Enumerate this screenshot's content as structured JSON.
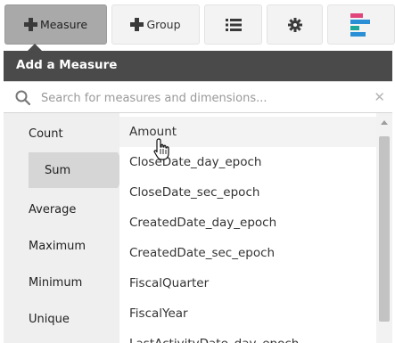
{
  "toolbar": {
    "measure_label": "Measure",
    "group_label": "Group",
    "list_icon": "list-icon",
    "settings_icon": "gear-icon",
    "chart_icon": "bar-chart-icon"
  },
  "panel": {
    "title": "Add a Measure",
    "search_placeholder": "Search for measures and dimensions...",
    "clear_icon": "close-icon"
  },
  "aggregates": [
    "Count",
    "Sum",
    "Average",
    "Maximum",
    "Minimum",
    "Unique"
  ],
  "selected_aggregate": "Sum",
  "fields": [
    "Amount",
    "CloseDate_day_epoch",
    "CloseDate_sec_epoch",
    "CreatedDate_day_epoch",
    "CreatedDate_sec_epoch",
    "FiscalQuarter",
    "FiscalYear",
    "LastActivityDate_day_epoch"
  ],
  "colors": {
    "active_button": "#a9a9a9",
    "panel_bg": "#4a4a4a",
    "chart_icon_pink": "#e0457b",
    "chart_icon_blue": "#2b8fd6",
    "chart_icon_teal": "#1fa89a"
  }
}
